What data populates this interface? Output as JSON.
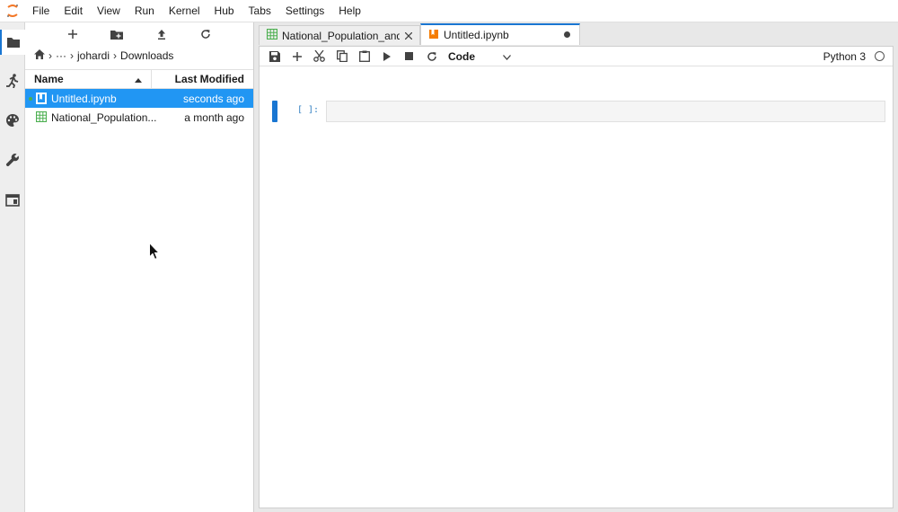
{
  "menu": [
    "File",
    "Edit",
    "View",
    "Run",
    "Kernel",
    "Hub",
    "Tabs",
    "Settings",
    "Help"
  ],
  "activity_bar": [
    {
      "name": "folder-icon",
      "active": true
    },
    {
      "name": "running-icon",
      "active": false
    },
    {
      "name": "palette-icon",
      "active": false
    },
    {
      "name": "wrench-icon",
      "active": false
    },
    {
      "name": "tabs-icon",
      "active": false
    }
  ],
  "filebrowser": {
    "breadcrumbs": {
      "ellipsis": "···",
      "user": "johardi",
      "folder": "Downloads"
    },
    "header": {
      "name": "Name",
      "modified": "Last Modified"
    },
    "rows": [
      {
        "name": "Untitled.ipynb",
        "modified": "seconds ago",
        "type": "notebook",
        "selected": true,
        "running": true
      },
      {
        "name": "National_Population...",
        "modified": "a month ago",
        "type": "csv",
        "selected": false,
        "running": false
      }
    ]
  },
  "tabs": [
    {
      "label": "National_Population_and_D",
      "type": "csv",
      "active": false
    },
    {
      "label": "Untitled.ipynb",
      "type": "notebook",
      "active": true
    }
  ],
  "notebook": {
    "cell_type": "Code",
    "kernel": "Python 3",
    "prompt": "[ ]:"
  },
  "colors": {
    "accent": "#1976d2",
    "selected_row": "#2196f3",
    "csv_icon": "#4caf50",
    "notebook_icon": "#f57c00"
  }
}
